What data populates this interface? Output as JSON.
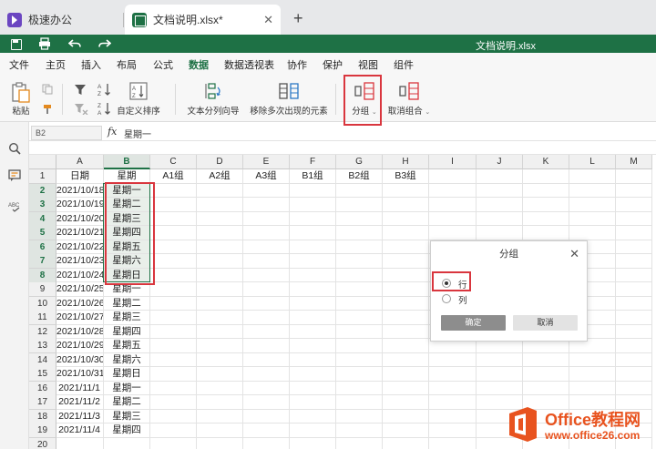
{
  "tabs": [
    {
      "label": "极速办公"
    },
    {
      "label": "文档说明.xlsx*"
    }
  ],
  "titlebar": {
    "filename": "文档说明.xlsx"
  },
  "menu": [
    "文件",
    "主页",
    "插入",
    "布局",
    "公式",
    "数据",
    "数据透视表",
    "协作",
    "保护",
    "视图",
    "组件"
  ],
  "menu_active": "数据",
  "ribbon": {
    "paste": "粘贴",
    "custom_sort": "自定义排序",
    "text_to_columns": "文本分列向导",
    "remove_duplicates": "移除多次出现的元素",
    "group": "分组",
    "ungroup": "取消组合"
  },
  "formula_bar": {
    "cell_ref": "B2",
    "fx": "fx",
    "value": "星期一"
  },
  "sheet": {
    "columns": [
      "A",
      "B",
      "C",
      "D",
      "E",
      "F",
      "G",
      "H",
      "I",
      "J",
      "K",
      "L",
      "M"
    ],
    "header_row": [
      "日期",
      "星期",
      "A1组",
      "A2组",
      "A3组",
      "B1组",
      "B2组",
      "B3组"
    ],
    "rows": [
      {
        "num": "1"
      },
      {
        "num": "2",
        "a": "2021/10/18",
        "b": "星期一"
      },
      {
        "num": "3",
        "a": "2021/10/19",
        "b": "星期二"
      },
      {
        "num": "4",
        "a": "2021/10/20",
        "b": "星期三"
      },
      {
        "num": "5",
        "a": "2021/10/21",
        "b": "星期四"
      },
      {
        "num": "6",
        "a": "2021/10/22",
        "b": "星期五"
      },
      {
        "num": "7",
        "a": "2021/10/23",
        "b": "星期六"
      },
      {
        "num": "8",
        "a": "2021/10/24",
        "b": "星期日"
      },
      {
        "num": "9",
        "a": "2021/10/25",
        "b": "星期一"
      },
      {
        "num": "10",
        "a": "2021/10/26",
        "b": "星期二"
      },
      {
        "num": "11",
        "a": "2021/10/27",
        "b": "星期三"
      },
      {
        "num": "12",
        "a": "2021/10/28",
        "b": "星期四"
      },
      {
        "num": "13",
        "a": "2021/10/29",
        "b": "星期五"
      },
      {
        "num": "14",
        "a": "2021/10/30",
        "b": "星期六"
      },
      {
        "num": "15",
        "a": "2021/10/31",
        "b": "星期日"
      },
      {
        "num": "16",
        "a": "2021/11/1",
        "b": "星期一"
      },
      {
        "num": "17",
        "a": "2021/11/2",
        "b": "星期二"
      },
      {
        "num": "18",
        "a": "2021/11/3",
        "b": "星期三"
      },
      {
        "num": "19",
        "a": "2021/11/4",
        "b": "星期四"
      },
      {
        "num": "20"
      }
    ]
  },
  "dialog": {
    "title": "分组",
    "options": [
      {
        "label": "行",
        "selected": true
      },
      {
        "label": "列",
        "selected": false
      }
    ],
    "ok": "确定",
    "cancel": "取消"
  },
  "watermark": {
    "title": "Office教程网",
    "url": "www.office26.com"
  },
  "colors": {
    "accent": "#1e7145",
    "highlight": "#d9363e",
    "watermark": "#e8531f"
  }
}
